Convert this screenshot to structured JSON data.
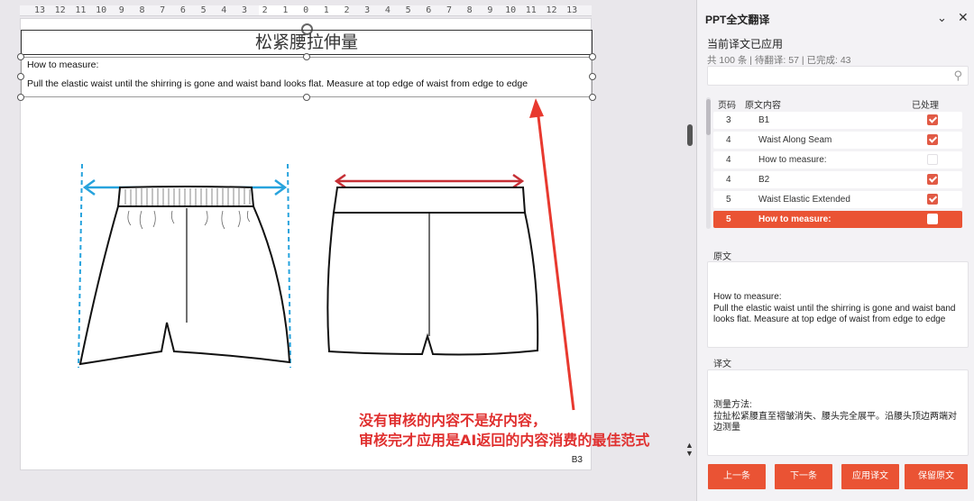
{
  "ruler": {
    "ticks": [
      "13",
      "12",
      "11",
      "10",
      "9",
      "8",
      "7",
      "6",
      "5",
      "4",
      "3",
      "2",
      "1",
      "0",
      "1",
      "2",
      "3",
      "4",
      "5",
      "6",
      "7",
      "8",
      "9",
      "10",
      "11",
      "12",
      "13"
    ]
  },
  "slide": {
    "title": "松紧腰拉伸量",
    "text_line1": "How to measure:",
    "text_line2": "Pull the elastic waist until the shirring is gone and waist band looks flat. Measure at top edge of waist from edge to edge",
    "page_label": "B3"
  },
  "annotation": {
    "line1": "没有审核的内容不是好内容，",
    "line2": "审核完才应用是AI返回的内容消费的最佳范式"
  },
  "panel": {
    "title": "PPT全文翻译",
    "status": "当前译文已应用",
    "stats": "共 100 条 | 待翻译: 57 | 已完成: 43",
    "search_placeholder": "",
    "table": {
      "headers": [
        "页码",
        "原文内容",
        "已处理"
      ],
      "rows": [
        {
          "page": "3",
          "text": "B1",
          "done": true
        },
        {
          "page": "4",
          "text": "Waist Along Seam",
          "done": true
        },
        {
          "page": "4",
          "text": "How to measure:",
          "done": false
        },
        {
          "page": "4",
          "text": "B2",
          "done": true
        },
        {
          "page": "5",
          "text": "Waist Elastic Extended",
          "done": true
        },
        {
          "page": "5",
          "text": "How to measure:",
          "done": false,
          "active": true
        }
      ]
    },
    "original_label": "原文",
    "original_text": "How to measure:\nPull the elastic waist until the shirring is gone and waist band looks flat. Measure at top edge of waist from edge to edge",
    "translation_label": "译文",
    "translation_text": "测量方法:\n拉扯松紧腰直至褶皱消失、腰头完全展平。沿腰头顶边两端对边测量",
    "buttons": {
      "prev": "上一条",
      "next": "下一条",
      "apply": "应用译文",
      "keep": "保留原文"
    }
  },
  "colors": {
    "accent": "#ea5334",
    "annotation": "#e0302f",
    "measure_blue": "#27a3dd",
    "measure_red": "#c62f35"
  }
}
